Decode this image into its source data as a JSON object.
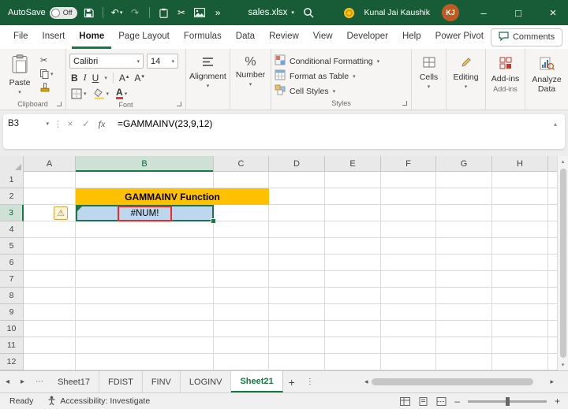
{
  "title_bar": {
    "autosave_label": "AutoSave",
    "autosave_state": "Off",
    "filename": "sales.xlsx",
    "user_name": "Kunal Jai Kaushik",
    "user_initials": "KJ",
    "window_controls": {
      "minimize": "–",
      "maximize": "□",
      "close": "×"
    }
  },
  "menu_bar": {
    "tabs": [
      {
        "label": "File",
        "active": false
      },
      {
        "label": "Insert",
        "active": false
      },
      {
        "label": "Home",
        "active": true
      },
      {
        "label": "Page Layout",
        "active": false
      },
      {
        "label": "Formulas",
        "active": false
      },
      {
        "label": "Data",
        "active": false
      },
      {
        "label": "Review",
        "active": false
      },
      {
        "label": "View",
        "active": false
      },
      {
        "label": "Developer",
        "active": false
      },
      {
        "label": "Help",
        "active": false
      },
      {
        "label": "Power Pivot",
        "active": false
      }
    ],
    "comments_label": "Comments"
  },
  "ribbon": {
    "paste_label": "Paste",
    "clipboard_group_label": "Clipboard",
    "font_name": "Calibri",
    "font_size": "14",
    "bold_label": "B",
    "italic_label": "I",
    "underline_label": "U",
    "grow_font_label": "A",
    "shrink_font_label": "A",
    "font_color_label": "A",
    "font_group_label": "Font",
    "alignment_label": "Alignment",
    "number_label": "Number",
    "conditional_formatting_label": "Conditional Formatting",
    "format_as_table_label": "Format as Table",
    "cell_styles_label": "Cell Styles",
    "styles_group_label": "Styles",
    "cells_label": "Cells",
    "editing_label": "Editing",
    "addins_label": "Add-ins",
    "addins_group_label": "Add-ins",
    "analyze_data_label": "Analyze Data"
  },
  "formula_bar": {
    "name_box_value": "B3",
    "fx_label": "fx",
    "formula": "=GAMMAINV(23,9,12)"
  },
  "grid": {
    "columns": [
      "A",
      "B",
      "C",
      "D",
      "E",
      "F",
      "G",
      "H"
    ],
    "rows": [
      "1",
      "2",
      "3",
      "4",
      "5",
      "6",
      "7",
      "8",
      "9",
      "10",
      "11",
      "12"
    ],
    "selected_cell": "B3",
    "title_cell": {
      "ref": "B2:C2",
      "text": "GAMMAINV Function",
      "bg_color": "#FFC000"
    },
    "error_cell": {
      "ref": "B3",
      "text": "#NUM!",
      "fill_color": "#BDD7EE",
      "border_color": "#FF2222"
    }
  },
  "sheet_tabs": {
    "tabs": [
      {
        "label": "Sheet17",
        "active": false
      },
      {
        "label": "FDIST",
        "active": false
      },
      {
        "label": "FINV",
        "active": false
      },
      {
        "label": "LOGINV",
        "active": false
      },
      {
        "label": "Sheet21",
        "active": true
      }
    ]
  },
  "status_bar": {
    "ready_label": "Ready",
    "accessibility_label": "Accessibility: Investigate"
  },
  "icons": {
    "undo": "↶",
    "redo": "↷",
    "cut": "✂",
    "more": "»",
    "chevron_down": "▾",
    "chevron_up": "▴",
    "left": "◂",
    "right": "▸",
    "ellipsis": "⋯",
    "vertical_dots": "⋮",
    "cancel": "×",
    "check": "✓",
    "warning": "⚠",
    "percent": "%",
    "plus": "+",
    "minus": "–"
  },
  "colors": {
    "titlebar_green": "#185C37",
    "accent_green": "#107C41",
    "title_cell_gold": "#FFC000",
    "error_fill_blue": "#BDD7EE",
    "error_border_red": "#FF2222",
    "avatar_orange": "#BF5B21"
  }
}
